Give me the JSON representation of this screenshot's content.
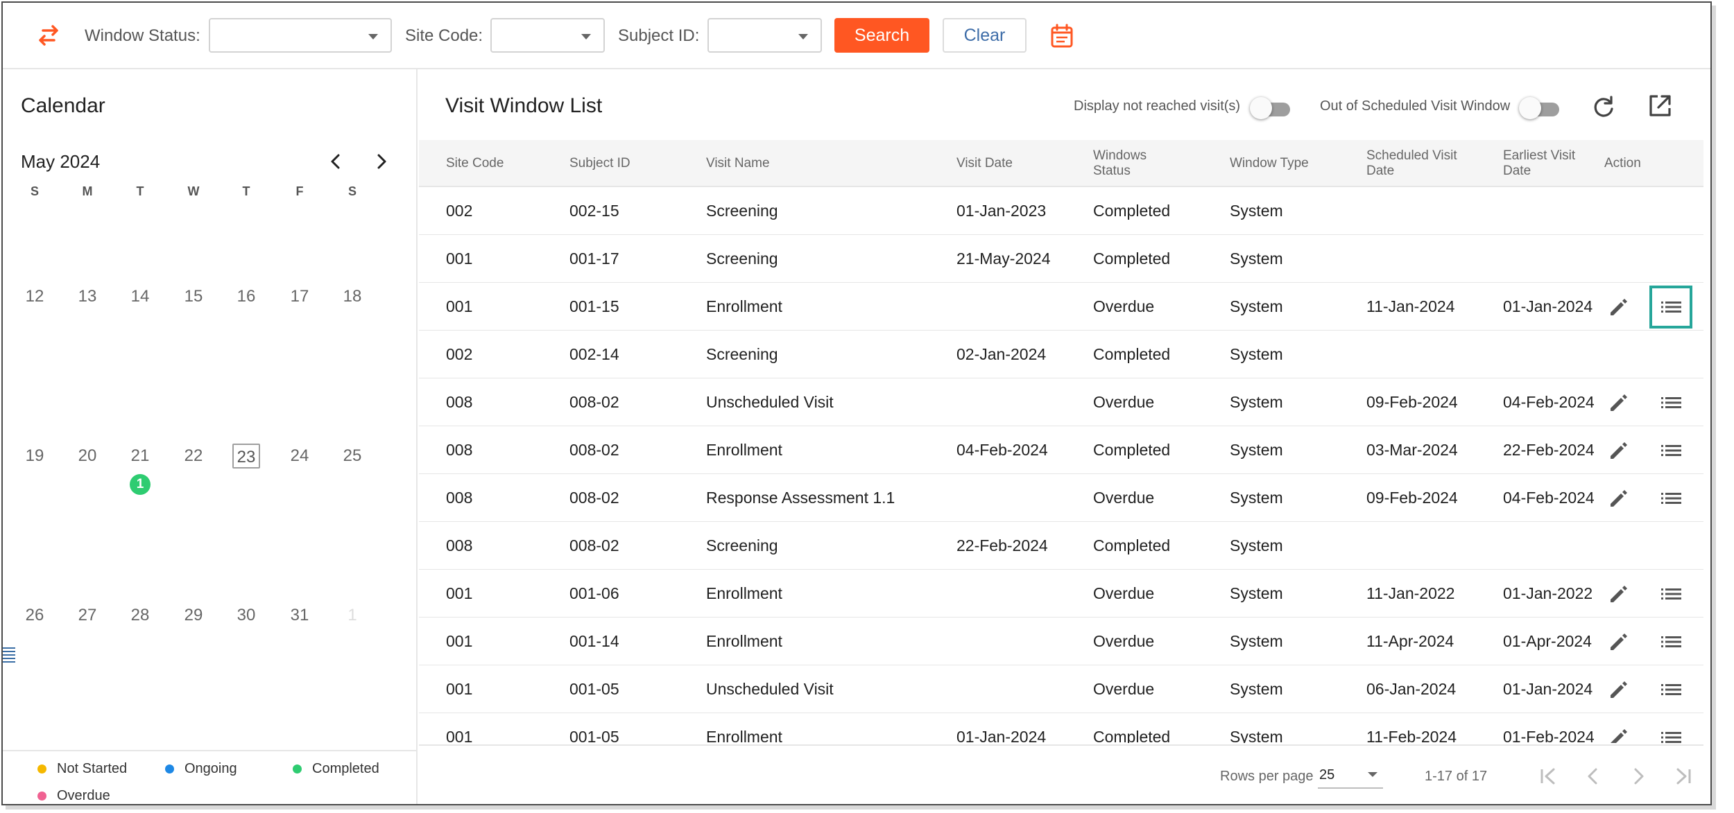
{
  "toolbar": {
    "window_status_label": "Window Status:",
    "window_status_value": "",
    "site_code_label": "Site Code:",
    "site_code_value": "",
    "subject_id_label": "Subject ID:",
    "subject_id_value": "",
    "search_label": "Search",
    "clear_label": "Clear"
  },
  "calendar": {
    "title": "Calendar",
    "month": "May 2024",
    "weekdays": [
      "S",
      "M",
      "T",
      "W",
      "T",
      "F",
      "S"
    ],
    "weeks": [
      [
        "12",
        "13",
        "14",
        "15",
        "16",
        "17",
        "18"
      ],
      [
        "19",
        "20",
        "21",
        "22",
        "23",
        "24",
        "25"
      ],
      [
        "26",
        "27",
        "28",
        "29",
        "30",
        "31",
        "1"
      ]
    ],
    "today": "23",
    "badge_day": "21",
    "badge_count": "1"
  },
  "legend": [
    {
      "label": "Not Started",
      "color": "#f5b800"
    },
    {
      "label": "Ongoing",
      "color": "#1e88e5"
    },
    {
      "label": "Completed",
      "color": "#2ecc71"
    },
    {
      "label": "Overdue",
      "color": "#f06292"
    }
  ],
  "list": {
    "title": "Visit Window List",
    "toggle_not_reached_label": "Display not reached visit(s)",
    "toggle_not_reached_on": false,
    "toggle_out_of_window_label": "Out of Scheduled Visit Window",
    "toggle_out_of_window_on": false,
    "columns": [
      "Site Code",
      "Subject ID",
      "Visit Name",
      "Visit Date",
      "Windows Status",
      "Window Type",
      "Scheduled Visit Date",
      "Earliest Visit Date",
      "Action"
    ],
    "rows": [
      {
        "site": "002",
        "subject": "002-15",
        "visit": "Screening",
        "visit_date": "01-Jan-2023",
        "status": "Completed",
        "type": "System",
        "scheduled": "",
        "earliest": "",
        "actions": false
      },
      {
        "site": "001",
        "subject": "001-17",
        "visit": "Screening",
        "visit_date": "21-May-2024",
        "status": "Completed",
        "type": "System",
        "scheduled": "",
        "earliest": "",
        "actions": false
      },
      {
        "site": "001",
        "subject": "001-15",
        "visit": "Enrollment",
        "visit_date": "",
        "status": "Overdue",
        "type": "System",
        "scheduled": "11-Jan-2024",
        "earliest": "01-Jan-2024",
        "actions": true
      },
      {
        "site": "002",
        "subject": "002-14",
        "visit": "Screening",
        "visit_date": "02-Jan-2024",
        "status": "Completed",
        "type": "System",
        "scheduled": "",
        "earliest": "",
        "actions": false
      },
      {
        "site": "008",
        "subject": "008-02",
        "visit": "Unscheduled Visit",
        "visit_date": "",
        "status": "Overdue",
        "type": "System",
        "scheduled": "09-Feb-2024",
        "earliest": "04-Feb-2024",
        "actions": true
      },
      {
        "site": "008",
        "subject": "008-02",
        "visit": "Enrollment",
        "visit_date": "04-Feb-2024",
        "status": "Completed",
        "type": "System",
        "scheduled": "03-Mar-2024",
        "earliest": "22-Feb-2024",
        "actions": true
      },
      {
        "site": "008",
        "subject": "008-02",
        "visit": "Response Assessment 1.1",
        "visit_date": "",
        "status": "Overdue",
        "type": "System",
        "scheduled": "09-Feb-2024",
        "earliest": "04-Feb-2024",
        "actions": true
      },
      {
        "site": "008",
        "subject": "008-02",
        "visit": "Screening",
        "visit_date": "22-Feb-2024",
        "status": "Completed",
        "type": "System",
        "scheduled": "",
        "earliest": "",
        "actions": false
      },
      {
        "site": "001",
        "subject": "001-06",
        "visit": "Enrollment",
        "visit_date": "",
        "status": "Overdue",
        "type": "System",
        "scheduled": "11-Jan-2022",
        "earliest": "01-Jan-2022",
        "actions": true
      },
      {
        "site": "001",
        "subject": "001-14",
        "visit": "Enrollment",
        "visit_date": "",
        "status": "Overdue",
        "type": "System",
        "scheduled": "11-Apr-2024",
        "earliest": "01-Apr-2024",
        "actions": true
      },
      {
        "site": "001",
        "subject": "001-05",
        "visit": "Unscheduled Visit",
        "visit_date": "",
        "status": "Overdue",
        "type": "System",
        "scheduled": "06-Jan-2024",
        "earliest": "01-Jan-2024",
        "actions": true
      },
      {
        "site": "001",
        "subject": "001-05",
        "visit": "Enrollment",
        "visit_date": "01-Jan-2024",
        "status": "Completed",
        "type": "System",
        "scheduled": "11-Feb-2024",
        "earliest": "01-Feb-2024",
        "actions": true
      }
    ],
    "highlighted_row": 2
  },
  "pagination": {
    "rows_per_page_label": "Rows per page",
    "rows_per_page_value": "25",
    "range": "1-17 of 17"
  },
  "colors": {
    "accent": "#ff5722",
    "highlight": "#26a69a",
    "badge": "#2ecc71"
  }
}
